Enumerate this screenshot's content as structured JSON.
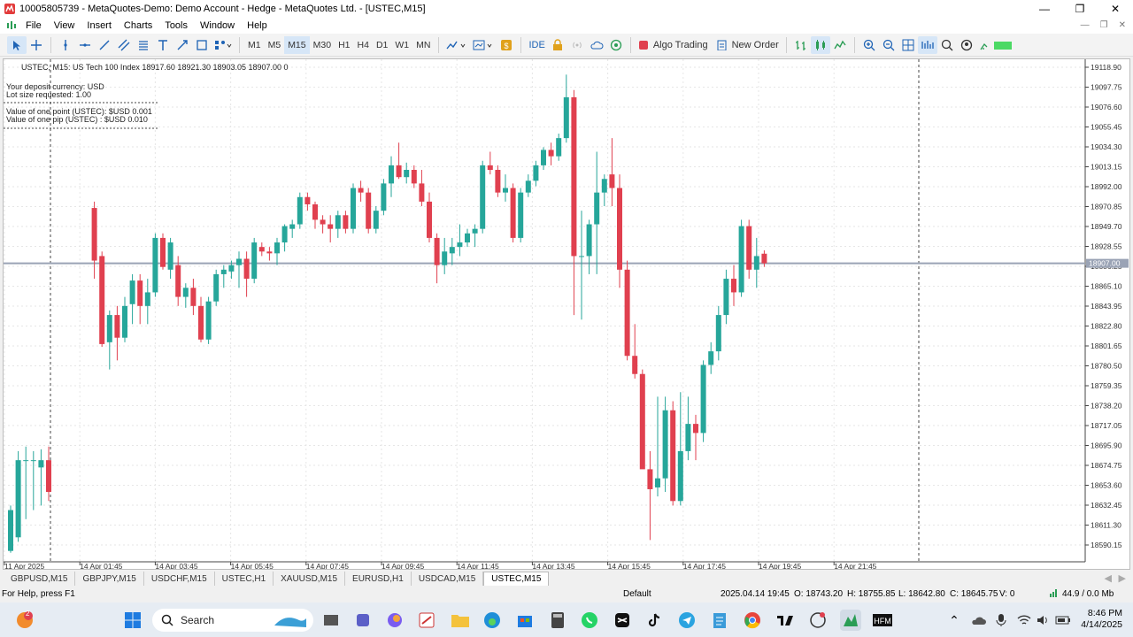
{
  "window": {
    "title": "10005805739 - MetaQuotes-Demo: Demo Account - Hedge - MetaQuotes Ltd. - [USTEC,M15]",
    "minimize": "—",
    "maximize": "❐",
    "close": "✕"
  },
  "menu": {
    "items": [
      "File",
      "View",
      "Insert",
      "Charts",
      "Tools",
      "Window",
      "Help"
    ]
  },
  "toolbar": {
    "timeframes": [
      "M1",
      "M5",
      "M15",
      "M30",
      "H1",
      "H4",
      "D1",
      "W1",
      "MN"
    ],
    "active_timeframe": "M15",
    "ide_label": "IDE",
    "algo_label": "Algo Trading",
    "new_order_label": "New Order"
  },
  "chart": {
    "header": "USTEC, M15:  US Tech 100 Index  18917.60 18921.30 18903.05 18907.00  0",
    "info_lines": [
      "Your deposit currency: USD",
      "Lot size requested: 1.00"
    ],
    "info_lines2": [
      "Value of one point (USTEC):  $USD 0.001",
      "Value of one pip    (USTEC) : $USD 0.010"
    ],
    "current_price_label": "18907.00",
    "colors": {
      "bull": "#26a69a",
      "bear": "#e0404f",
      "price_line": "#9aa3b5",
      "grid": "#e6e6e6"
    }
  },
  "chart_data": {
    "type": "candlestick",
    "symbol": "USTEC",
    "timeframe": "M15",
    "y_ticks": [
      "19118.90",
      "19097.75",
      "19076.60",
      "19055.45",
      "19034.30",
      "19013.15",
      "18992.00",
      "18970.85",
      "18949.70",
      "18928.55",
      "18886.25",
      "18865.10",
      "18843.95",
      "18822.80",
      "18801.65",
      "18780.50",
      "18759.35",
      "18738.20",
      "18717.05",
      "18695.90",
      "18674.75",
      "18653.60",
      "18632.45",
      "18611.30",
      "18590.15"
    ],
    "x_ticks": [
      "11 Apr 2025",
      "14 Apr 01:45",
      "14 Apr 03:45",
      "14 Apr 05:45",
      "14 Apr 07:45",
      "14 Apr 09:45",
      "14 Apr 11:45",
      "14 Apr 13:45",
      "14 Apr 15:45",
      "14 Apr 17:45",
      "14 Apr 19:45",
      "14 Apr 21:45"
    ],
    "ylim": [
      18578,
      19128
    ],
    "current_price": 18907.0,
    "candles": [
      {
        "o": 18590,
        "h": 18640,
        "l": 18588,
        "c": 18635
      },
      {
        "o": 18605,
        "h": 18700,
        "l": 18600,
        "c": 18690
      },
      {
        "o": 18690,
        "h": 18705,
        "l": 18625,
        "c": 18690
      },
      {
        "o": 18690,
        "h": 18700,
        "l": 18635,
        "c": 18690
      },
      {
        "o": 18682,
        "h": 18702,
        "l": 18640,
        "c": 18690
      },
      {
        "o": 18690,
        "h": 18705,
        "l": 18645,
        "c": 18655
      },
      {
        "o": 18968,
        "h": 18975,
        "l": 18890,
        "c": 18910
      },
      {
        "o": 18915,
        "h": 18920,
        "l": 18815,
        "c": 18818
      },
      {
        "o": 18820,
        "h": 18855,
        "l": 18790,
        "c": 18850
      },
      {
        "o": 18850,
        "h": 18860,
        "l": 18800,
        "c": 18825
      },
      {
        "o": 18825,
        "h": 18870,
        "l": 18820,
        "c": 18860
      },
      {
        "o": 18862,
        "h": 18895,
        "l": 18840,
        "c": 18888
      },
      {
        "o": 18888,
        "h": 18895,
        "l": 18840,
        "c": 18860
      },
      {
        "o": 18860,
        "h": 18890,
        "l": 18840,
        "c": 18875
      },
      {
        "o": 18875,
        "h": 18940,
        "l": 18870,
        "c": 18935
      },
      {
        "o": 18935,
        "h": 18940,
        "l": 18900,
        "c": 18903
      },
      {
        "o": 18900,
        "h": 18935,
        "l": 18890,
        "c": 18930
      },
      {
        "o": 18905,
        "h": 18915,
        "l": 18860,
        "c": 18870
      },
      {
        "o": 18870,
        "h": 18885,
        "l": 18858,
        "c": 18880
      },
      {
        "o": 18880,
        "h": 18890,
        "l": 18850,
        "c": 18860
      },
      {
        "o": 18860,
        "h": 18870,
        "l": 18820,
        "c": 18823
      },
      {
        "o": 18823,
        "h": 18870,
        "l": 18818,
        "c": 18865
      },
      {
        "o": 18865,
        "h": 18900,
        "l": 18860,
        "c": 18895
      },
      {
        "o": 18895,
        "h": 18905,
        "l": 18880,
        "c": 18900
      },
      {
        "o": 18898,
        "h": 18910,
        "l": 18890,
        "c": 18905
      },
      {
        "o": 18905,
        "h": 18920,
        "l": 18880,
        "c": 18912
      },
      {
        "o": 18912,
        "h": 18920,
        "l": 18870,
        "c": 18890
      },
      {
        "o": 18890,
        "h": 18935,
        "l": 18885,
        "c": 18930
      },
      {
        "o": 18925,
        "h": 18930,
        "l": 18915,
        "c": 18920
      },
      {
        "o": 18920,
        "h": 18925,
        "l": 18910,
        "c": 18918
      },
      {
        "o": 18918,
        "h": 18935,
        "l": 18905,
        "c": 18930
      },
      {
        "o": 18930,
        "h": 18950,
        "l": 18920,
        "c": 18948
      },
      {
        "o": 18945,
        "h": 18955,
        "l": 18935,
        "c": 18950
      },
      {
        "o": 18950,
        "h": 18985,
        "l": 18945,
        "c": 18980
      },
      {
        "o": 18980,
        "h": 18985,
        "l": 18965,
        "c": 18972
      },
      {
        "o": 18972,
        "h": 18975,
        "l": 18945,
        "c": 18955
      },
      {
        "o": 18955,
        "h": 18960,
        "l": 18940,
        "c": 18950
      },
      {
        "o": 18950,
        "h": 18960,
        "l": 18930,
        "c": 18945
      },
      {
        "o": 18945,
        "h": 18965,
        "l": 18935,
        "c": 18960
      },
      {
        "o": 18960,
        "h": 18965,
        "l": 18940,
        "c": 18945
      },
      {
        "o": 18945,
        "h": 18995,
        "l": 18940,
        "c": 18990
      },
      {
        "o": 18990,
        "h": 18998,
        "l": 18975,
        "c": 18985
      },
      {
        "o": 18985,
        "h": 18990,
        "l": 18940,
        "c": 18945
      },
      {
        "o": 18945,
        "h": 18970,
        "l": 18940,
        "c": 18965
      },
      {
        "o": 18965,
        "h": 19000,
        "l": 18960,
        "c": 18995
      },
      {
        "o": 18995,
        "h": 19025,
        "l": 18980,
        "c": 19015
      },
      {
        "o": 19015,
        "h": 19040,
        "l": 19000,
        "c": 19002
      },
      {
        "o": 19002,
        "h": 19018,
        "l": 18995,
        "c": 19010
      },
      {
        "o": 19010,
        "h": 19015,
        "l": 18990,
        "c": 18995
      },
      {
        "o": 18995,
        "h": 19010,
        "l": 18970,
        "c": 18975
      },
      {
        "o": 18975,
        "h": 18985,
        "l": 18930,
        "c": 18935
      },
      {
        "o": 18935,
        "h": 18940,
        "l": 18885,
        "c": 18905
      },
      {
        "o": 18905,
        "h": 18935,
        "l": 18895,
        "c": 18920
      },
      {
        "o": 18918,
        "h": 18935,
        "l": 18905,
        "c": 18925
      },
      {
        "o": 18925,
        "h": 18950,
        "l": 18915,
        "c": 18930
      },
      {
        "o": 18930,
        "h": 18945,
        "l": 18925,
        "c": 18940
      },
      {
        "o": 18940,
        "h": 18950,
        "l": 18925,
        "c": 18945
      },
      {
        "o": 18945,
        "h": 19020,
        "l": 18940,
        "c": 19015
      },
      {
        "o": 19015,
        "h": 19030,
        "l": 19005,
        "c": 19010
      },
      {
        "o": 19010,
        "h": 19015,
        "l": 18980,
        "c": 18985
      },
      {
        "o": 18985,
        "h": 19005,
        "l": 18975,
        "c": 18990
      },
      {
        "o": 18990,
        "h": 18995,
        "l": 18930,
        "c": 18935
      },
      {
        "o": 18935,
        "h": 18990,
        "l": 18930,
        "c": 18985
      },
      {
        "o": 18985,
        "h": 19005,
        "l": 18980,
        "c": 18998
      },
      {
        "o": 18998,
        "h": 19020,
        "l": 18992,
        "c": 19015
      },
      {
        "o": 19015,
        "h": 19035,
        "l": 19010,
        "c": 19032
      },
      {
        "o": 19032,
        "h": 19040,
        "l": 19015,
        "c": 19025
      },
      {
        "o": 19025,
        "h": 19050,
        "l": 19020,
        "c": 19045
      },
      {
        "o": 19045,
        "h": 19115,
        "l": 19040,
        "c": 19090
      },
      {
        "o": 19090,
        "h": 19098,
        "l": 18850,
        "c": 18915
      },
      {
        "o": 18915,
        "h": 18965,
        "l": 18845,
        "c": 18915
      },
      {
        "o": 18915,
        "h": 18955,
        "l": 18895,
        "c": 18950
      },
      {
        "o": 18950,
        "h": 19030,
        "l": 18895,
        "c": 18985
      },
      {
        "o": 18985,
        "h": 19005,
        "l": 18970,
        "c": 19000
      },
      {
        "o": 19005,
        "h": 19045,
        "l": 18970,
        "c": 18990
      },
      {
        "o": 18990,
        "h": 19005,
        "l": 18880,
        "c": 18900
      },
      {
        "o": 18900,
        "h": 18910,
        "l": 18800,
        "c": 18805
      },
      {
        "o": 18805,
        "h": 18840,
        "l": 18780,
        "c": 18785
      },
      {
        "o": 18785,
        "h": 18790,
        "l": 18720,
        "c": 18680
      },
      {
        "o": 18680,
        "h": 18700,
        "l": 18602,
        "c": 18658
      },
      {
        "o": 18660,
        "h": 18760,
        "l": 18650,
        "c": 18670
      },
      {
        "o": 18670,
        "h": 18760,
        "l": 18655,
        "c": 18745
      },
      {
        "o": 18745,
        "h": 18755,
        "l": 18640,
        "c": 18645
      },
      {
        "o": 18645,
        "h": 18765,
        "l": 18640,
        "c": 18700
      },
      {
        "o": 18700,
        "h": 18760,
        "l": 18690,
        "c": 18730
      },
      {
        "o": 18730,
        "h": 18740,
        "l": 18690,
        "c": 18720
      },
      {
        "o": 18720,
        "h": 18800,
        "l": 18710,
        "c": 18795
      },
      {
        "o": 18795,
        "h": 18820,
        "l": 18785,
        "c": 18810
      },
      {
        "o": 18810,
        "h": 18860,
        "l": 18800,
        "c": 18850
      },
      {
        "o": 18850,
        "h": 18900,
        "l": 18840,
        "c": 18890
      },
      {
        "o": 18890,
        "h": 18905,
        "l": 18860,
        "c": 18875
      },
      {
        "o": 18875,
        "h": 18955,
        "l": 18870,
        "c": 18948
      },
      {
        "o": 18948,
        "h": 18955,
        "l": 18890,
        "c": 18900
      },
      {
        "o": 18900,
        "h": 18935,
        "l": 18880,
        "c": 18915
      },
      {
        "o": 18917.6,
        "h": 18921.3,
        "l": 18903.05,
        "c": 18907
      }
    ]
  },
  "tabs": [
    "GBPUSD,M15",
    "GBPJPY,M15",
    "USDCHF,M15",
    "USTEC,H1",
    "XAUUSD,M15",
    "EURUSD,H1",
    "USDCAD,M15",
    "USTEC,M15"
  ],
  "active_tab": "USTEC,M15",
  "status": {
    "help": "For Help, press F1",
    "profile": "Default",
    "datetime": "2025.04.14 19:45",
    "open": "O: 18743.20",
    "high": "H: 18755.85",
    "low": "L: 18642.80",
    "close": "C: 18645.75",
    "volume": "V: 0",
    "traffic": "44.9 / 0.0 Mb"
  },
  "taskbar": {
    "search_label": "Search",
    "notification_count": "2",
    "time": "8:46 PM",
    "date": "4/14/2025"
  }
}
